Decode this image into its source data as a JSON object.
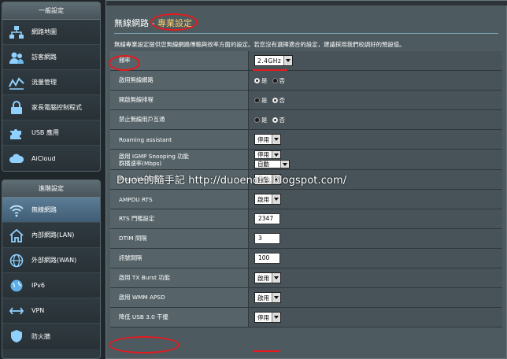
{
  "sidebar": {
    "general_header": "一般設定",
    "general_items": [
      {
        "label": "網路地圖",
        "icon": "network-map-icon"
      },
      {
        "label": "訪客網路",
        "icon": "guest-network-icon"
      },
      {
        "label": "流量管理",
        "icon": "traffic-manager-icon"
      },
      {
        "label": "家長電腦控制程式",
        "icon": "parental-control-icon"
      },
      {
        "label": "USB 應用",
        "icon": "usb-puzzle-icon"
      },
      {
        "label": "AiCloud",
        "icon": "aicloud-icon"
      }
    ],
    "advanced_header": "進階設定",
    "advanced_items": [
      {
        "label": "無線網路",
        "icon": "wifi-icon",
        "active": true
      },
      {
        "label": "內部網路(LAN)",
        "icon": "home-icon"
      },
      {
        "label": "外部網路(WAN)",
        "icon": "globe-icon"
      },
      {
        "label": "IPv6",
        "icon": "ipv6-globe-icon"
      },
      {
        "label": "VPN",
        "icon": "vpn-icon"
      },
      {
        "label": "防火牆",
        "icon": "firewall-shield-icon"
      }
    ]
  },
  "main": {
    "title_prefix": "無線網路 - ",
    "title_accent": "專業設定",
    "description": "無線專業設定提供您無線網路傳輸與效率方面的設定。若您沒有選擇適合的設定，建議採用我們校調好的預設值。",
    "rows": [
      {
        "label": "頻率",
        "type": "select",
        "value": "2.4GHz"
      },
      {
        "label": "啟用無線網路",
        "type": "radio",
        "options": [
          "是",
          "否"
        ],
        "selected": 0
      },
      {
        "label": "開啟無線排程",
        "type": "radio",
        "options": [
          "是",
          "否"
        ],
        "selected": 1
      },
      {
        "label": "禁止無線用戶互通",
        "type": "radio",
        "options": [
          "是",
          "否"
        ],
        "selected": 1
      },
      {
        "label": "Roaming assistant",
        "type": "select",
        "value": "停用"
      },
      {
        "label": "啟用 IGMP Snooping 功能",
        "label2": "群播速率(Mbps)",
        "type": "select",
        "value": "停用",
        "value2": "自動"
      },
      {
        "label": "Preamble 類型",
        "type": "select",
        "value": "自動"
      },
      {
        "label": "AMPDU RTS",
        "type": "select",
        "value": "啟用"
      },
      {
        "label": "RTS 門檻設定",
        "type": "text",
        "value": "2347"
      },
      {
        "label": "DTIM 間隔",
        "type": "text",
        "value": "3"
      },
      {
        "label": "訊號間隔",
        "type": "text",
        "value": "100"
      },
      {
        "label": "啟用 TX Burst 功能",
        "type": "select",
        "value": "啟用"
      },
      {
        "label": "啟用 WMM APSD",
        "type": "select",
        "value": "啟用"
      },
      {
        "label": "降低 USB 3.0 干擾",
        "type": "select",
        "value": "停用"
      }
    ]
  },
  "watermark": "Duoe的隨手記 http://duoenote.blogspot.com/",
  "colors": {
    "annotation_red": "#e8191e",
    "accent_title": "#ffcc66",
    "active_menu": "#4d6d83"
  }
}
